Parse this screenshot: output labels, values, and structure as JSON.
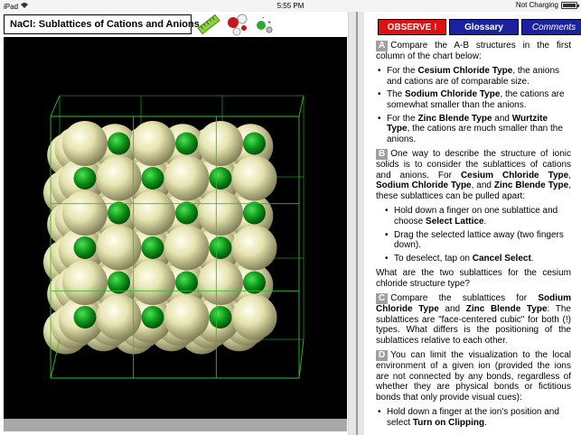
{
  "status_bar": {
    "device": "iPad",
    "time": "5:55 PM",
    "charging": "Not Charging"
  },
  "app": {
    "title": "NaCl: Sublattices of Cations and Anions"
  },
  "tabs": {
    "observe": "OBSERVE !",
    "glossary": "Glossary",
    "comments": "Comments"
  },
  "colors": {
    "anion": "#e8e6b4",
    "cation": "#0b8c16",
    "observe": "#e01010",
    "glossary": "#1a22a0",
    "marker": "#a0a0a0"
  },
  "text": {
    "a_marker": "A",
    "a_intro": "Compare the A-B structures in the first column of the chart below:",
    "a_b1_pre": "For the ",
    "a_b1_bold": "Cesium Chloride Type",
    "a_b1_post": ", the anions and cations are of comparable size.",
    "a_b2_pre": "The ",
    "a_b2_bold": "Sodium Chloride Type",
    "a_b2_post": ", the cations are somewhat smaller than the anions.",
    "a_b3_pre": "For the ",
    "a_b3_bold1": "Zinc Blende Type",
    "a_b3_mid": " and ",
    "a_b3_bold2": "Wurtzite Type",
    "a_b3_post": ", the cations are much smaller than the anions.",
    "b_marker": "B",
    "b_pre": "One way to describe the structure of ionic solids is to consider the sublattices of cations and anions. For ",
    "b_bold1": "Cesium Chloride Type",
    "b_sep1": ", ",
    "b_bold2": "Sodium Chloride Type",
    "b_sep2": ", and ",
    "b_bold3": "Zinc Blende Type",
    "b_post": ", these sublattices can be pulled apart:",
    "b_i1_pre": "Hold down a finger on one sublattice and choose ",
    "b_i1_bold": "Select Lattice",
    "b_i1_post": ".",
    "b_i2": "Drag the selected lattice away (two fingers down).",
    "b_i3_pre": "To deselect, tap on ",
    "b_i3_bold": "Cancel Select",
    "b_i3_post": ".",
    "b_question": "What are the two sublattices for the cesium chloride structure type?",
    "c_marker": "C",
    "c_pre": "Compare the sublattices for ",
    "c_bold1": "Sodium Chloride Type",
    "c_mid": " and ",
    "c_bold2": "Zinc Blende Type",
    "c_post": ": The sublattices are \"face-centered cubic\" for both (!) types. What differs is the positioning of the sublattices relative to each other.",
    "d_marker": "D",
    "d_text": "You can limit the visualization to the local environment of a given ion (provided the ions are not connected by any bonds, regardless of whether they are physical bonds or fictitious bonds that only provide visual cues):",
    "d_b1_pre": "Hold down a finger at the ion's position and select ",
    "d_b1_bold": "Turn on Clipping",
    "d_b1_post": "."
  }
}
